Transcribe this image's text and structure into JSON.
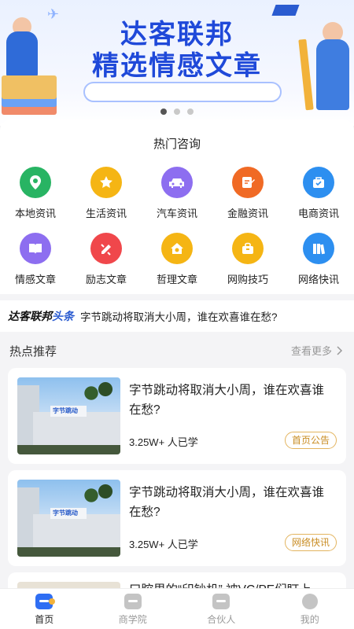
{
  "banner": {
    "title_line1": "达客联邦",
    "title_line2": "精选情感文章",
    "slides": 3,
    "active_slide": 0
  },
  "hot_consult": {
    "title": "热门咨询",
    "items": [
      {
        "label": "本地资讯",
        "icon": "location-pin-icon",
        "color": "#28b463"
      },
      {
        "label": "生活资讯",
        "icon": "star-icon",
        "color": "#f5b514"
      },
      {
        "label": "汽车资讯",
        "icon": "car-icon",
        "color": "#8d6ef0"
      },
      {
        "label": "金融资讯",
        "icon": "document-edit-icon",
        "color": "#f06a25"
      },
      {
        "label": "电商资讯",
        "icon": "shopping-bag-icon",
        "color": "#2d8ff0"
      },
      {
        "label": "情感文章",
        "icon": "book-icon",
        "color": "#8d6ef0"
      },
      {
        "label": "励志文章",
        "icon": "pencil-icon",
        "color": "#f0474b"
      },
      {
        "label": "哲理文章",
        "icon": "house-icon",
        "color": "#f5b514"
      },
      {
        "label": "网购技巧",
        "icon": "basket-icon",
        "color": "#f5b514"
      },
      {
        "label": "网络快讯",
        "icon": "books-icon",
        "color": "#2d8ff0"
      }
    ]
  },
  "headline": {
    "brand_main": "达客联邦",
    "brand_highlight": "头条",
    "text": "字节跳动将取消大小周，谁在欢喜谁在愁?"
  },
  "recommend": {
    "title": "热点推荐",
    "see_more": "查看更多",
    "articles": [
      {
        "title": "字节跳动将取消大小周，谁在欢喜谁在愁?",
        "count": "3.25W+ 人已学",
        "tag": "首页公告",
        "thumb_sign": "字节跳动"
      },
      {
        "title": "字节跳动将取消大小周，谁在欢喜谁在愁?",
        "count": "3.25W+ 人已学",
        "tag": "网络快讯",
        "thumb_sign": "字节跳动"
      },
      {
        "title": "口腔里的“印钞机” 被VC/PE们盯上",
        "count": "",
        "tag": "",
        "thumb_sign": ""
      }
    ]
  },
  "tabbar": {
    "tabs": [
      {
        "label": "首页",
        "icon": "home-icon",
        "active": true
      },
      {
        "label": "商学院",
        "icon": "school-icon",
        "active": false
      },
      {
        "label": "合伙人",
        "icon": "partner-icon",
        "active": false
      },
      {
        "label": "我的",
        "icon": "user-icon",
        "active": false
      }
    ]
  }
}
